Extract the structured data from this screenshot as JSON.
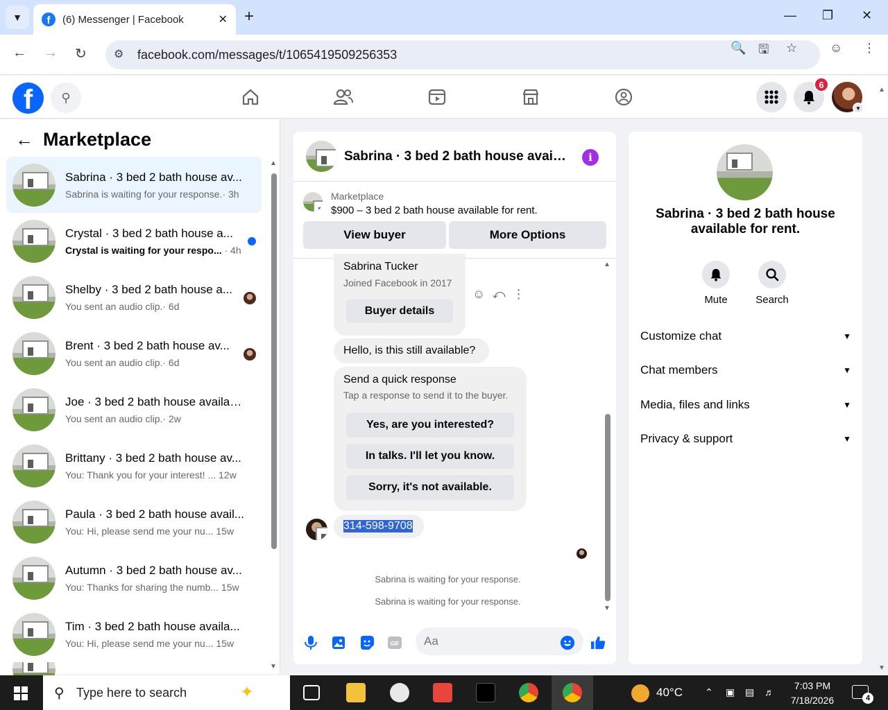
{
  "browser": {
    "tab_title": "(6) Messenger | Facebook",
    "url": "facebook.com/messages/t/1065419509256353"
  },
  "fb_header": {
    "notification_count": "6"
  },
  "sidebar": {
    "title": "Marketplace",
    "conversations": [
      {
        "name": "Sabrina · 3 bed 2 bath house av...",
        "preview": "Sabrina is waiting for your response.",
        "time": "· 3h",
        "active": true
      },
      {
        "name": "Crystal · 3 bed 2 bath house a...",
        "preview": "Crystal is waiting for your respo...",
        "time": "· 4h",
        "unread": true
      },
      {
        "name": "Shelby · 3 bed 2 bath house a...",
        "preview": "You sent an audio clip.",
        "time": "· 6d"
      },
      {
        "name": "Brent · 3 bed 2 bath house av...",
        "preview": "You sent an audio clip.",
        "time": "· 6d"
      },
      {
        "name": "Joe · 3 bed 2 bath house availab...",
        "preview": "You sent an audio clip.",
        "time": "· 2w"
      },
      {
        "name": "Brittany · 3 bed 2 bath house av...",
        "preview": "You: Thank you for your interest! ...",
        "time": "12w"
      },
      {
        "name": "Paula · 3 bed 2 bath house avail...",
        "preview": "You: Hi, please send me your nu...",
        "time": "15w"
      },
      {
        "name": "Autumn · 3 bed 2 bath house av...",
        "preview": "You: Thanks for sharing the numb...",
        "time": "15w"
      },
      {
        "name": "Tim · 3 bed 2 bath house availa...",
        "preview": "You: Hi, please send me your nu...",
        "time": "15w"
      }
    ]
  },
  "chat": {
    "title": "Sabrina · 3 bed 2 bath house availa...",
    "marketplace_label": "Marketplace",
    "listing": "$900 – 3 bed 2 bath house available for rent.",
    "view_buyer": "View buyer",
    "more_options": "More Options",
    "buyer_name": "Sabrina Tucker",
    "buyer_joined": "Joined Facebook in 2017",
    "buyer_details": "Buyer details",
    "message1": "Hello, is this still available?",
    "quick_title": "Send a quick response",
    "quick_sub": "Tap a response to send it to the buyer.",
    "quick_replies": [
      "Yes, are you interested?",
      "In talks. I'll let you know.",
      "Sorry, it's not available."
    ],
    "phone_message": "314-598-9708",
    "status1": "Sabrina is waiting for your response.",
    "status2": "Sabrina is waiting for your response.",
    "composer_placeholder": "Aa"
  },
  "right_panel": {
    "name": "Sabrina · 3 bed 2 bath house available for rent.",
    "mute": "Mute",
    "search": "Search",
    "sections": [
      "Customize chat",
      "Chat members",
      "Media, files and links",
      "Privacy & support"
    ]
  },
  "taskbar": {
    "search_placeholder": "Type here to search",
    "temperature": "40°C",
    "time": "7:03 PM",
    "date": "7/18/2026",
    "notif_count": "4"
  }
}
